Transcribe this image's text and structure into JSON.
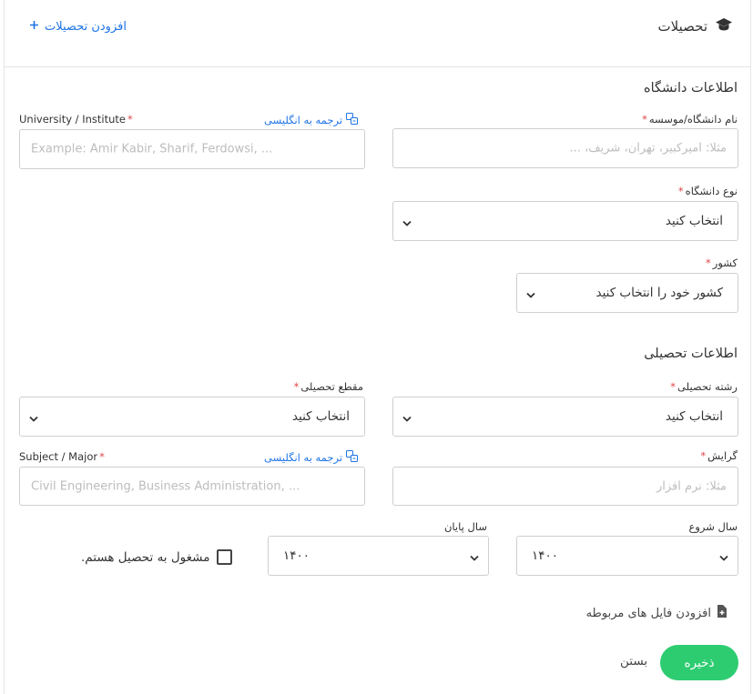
{
  "header": {
    "title": "تحصیلات",
    "add_label": "افزودن تحصیلات"
  },
  "university_section": {
    "title": "اطلاعات دانشگاه",
    "name_fa": {
      "label": "نام دانشگاه/موسسه",
      "placeholder": "مثلا: امیرکبیر، تهران، شریف، ..."
    },
    "name_en": {
      "label": "University / Institute",
      "placeholder": "Example: Amir Kabir, Sharif, Ferdowsi, ...",
      "translate_label": "ترجمه به انگلیسی"
    },
    "type": {
      "label": "نوع دانشگاه",
      "value": "انتخاب کنید"
    },
    "country": {
      "label": "کشور",
      "value": "کشور خود را انتخاب کنید"
    }
  },
  "education_section": {
    "title": "اطلاعات تحصیلی",
    "field": {
      "label": "رشته تحصیلی",
      "value": "انتخاب کنید"
    },
    "degree": {
      "label": "مقطع تحصیلی",
      "value": "انتخاب کنید"
    },
    "orientation": {
      "label": "گرایش",
      "placeholder": "مثلا: نرم افزار"
    },
    "subject_en": {
      "label": "Subject / Major",
      "placeholder": "Civil Engineering, Business Administration, ...",
      "translate_label": "ترجمه به انگلیسی"
    },
    "start_year": {
      "label": "سال شروع",
      "value": "۱۴۰۰"
    },
    "end_year": {
      "label": "سال پایان",
      "value": "۱۴۰۰"
    },
    "studying_label": "مشغول به تحصیل هستم."
  },
  "attach_label": "افزودن فایل های مربوطه",
  "footer": {
    "save_label": "ذخیره",
    "close_label": "بستن"
  },
  "colors": {
    "accent": "#1e74e6",
    "required": "#e0464b",
    "save": "#2ecc71"
  }
}
